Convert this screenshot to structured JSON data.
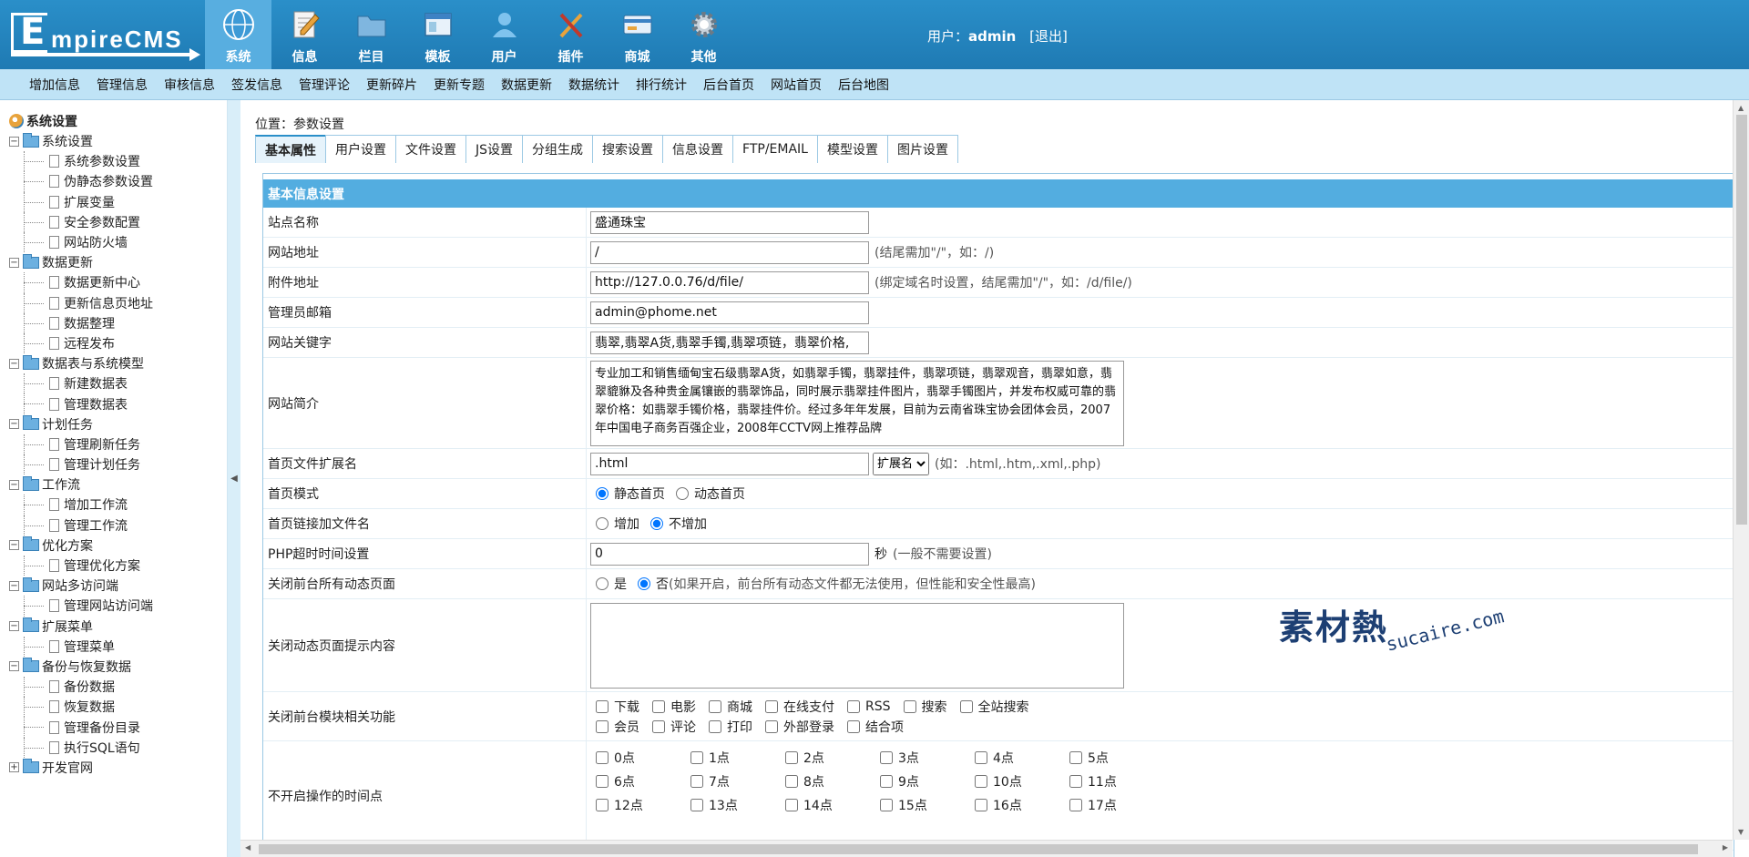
{
  "header": {
    "logo_text": "EmpireCMS",
    "nav": [
      {
        "label": "系统",
        "icon": "globe-icon",
        "active": true
      },
      {
        "label": "信息",
        "icon": "edit-icon"
      },
      {
        "label": "栏目",
        "icon": "folder-icon"
      },
      {
        "label": "模板",
        "icon": "window-icon"
      },
      {
        "label": "用户",
        "icon": "user-icon"
      },
      {
        "label": "插件",
        "icon": "tools-icon"
      },
      {
        "label": "商城",
        "icon": "card-icon"
      },
      {
        "label": "其他",
        "icon": "gear-icon"
      }
    ],
    "user_prefix": "用户：",
    "user_name": "admin",
    "logout": "[退出]"
  },
  "submenu": [
    "增加信息",
    "管理信息",
    "审核信息",
    "签发信息",
    "管理评论",
    "更新碎片",
    "更新专题",
    "数据更新",
    "数据统计",
    "排行统计",
    "后台首页",
    "网站首页",
    "后台地图"
  ],
  "sidebar": {
    "root": "系统设置",
    "groups": [
      {
        "label": "系统设置",
        "items": [
          "系统参数设置",
          "伪静态参数设置",
          "扩展变量",
          "安全参数配置",
          "网站防火墙"
        ]
      },
      {
        "label": "数据更新",
        "items": [
          "数据更新中心",
          "更新信息页地址",
          "数据整理",
          "远程发布"
        ]
      },
      {
        "label": "数据表与系统模型",
        "items": [
          "新建数据表",
          "管理数据表"
        ]
      },
      {
        "label": "计划任务",
        "items": [
          "管理刷新任务",
          "管理计划任务"
        ]
      },
      {
        "label": "工作流",
        "items": [
          "增加工作流",
          "管理工作流"
        ]
      },
      {
        "label": "优化方案",
        "items": [
          "管理优化方案"
        ]
      },
      {
        "label": "网站多访问端",
        "items": [
          "管理网站访问端"
        ]
      },
      {
        "label": "扩展菜单",
        "items": [
          "管理菜单"
        ]
      },
      {
        "label": "备份与恢复数据",
        "items": [
          "备份数据",
          "恢复数据",
          "管理备份目录",
          "执行SQL语句"
        ]
      },
      {
        "label": "开发官网",
        "items": []
      }
    ]
  },
  "main": {
    "location_prefix": "位置：",
    "location": "参数设置",
    "tabs": [
      "基本属性",
      "用户设置",
      "文件设置",
      "JS设置",
      "分组生成",
      "搜索设置",
      "信息设置",
      "FTP/EMAIL",
      "模型设置",
      "图片设置"
    ],
    "section_title": "基本信息设置",
    "fields": {
      "site_name": {
        "label": "站点名称",
        "value": "盛通珠宝"
      },
      "site_url": {
        "label": "网站地址",
        "value": "/",
        "hint": "(结尾需加\"/\"，如：/)"
      },
      "file_url": {
        "label": "附件地址",
        "value": "http://127.0.0.76/d/file/",
        "hint": "(绑定域名时设置，结尾需加\"/\"，如：/d/file/)"
      },
      "admin_email": {
        "label": "管理员邮箱",
        "value": "admin@phome.net"
      },
      "keywords": {
        "label": "网站关键字",
        "value": "翡翠,翡翠A货,翡翠手镯,翡翠项链，翡翠价格,"
      },
      "intro": {
        "label": "网站简介",
        "value": "专业加工和销售缅甸宝石级翡翠A货，如翡翠手镯，翡翠挂件，翡翠项链，翡翠观音，翡翠如意，翡翠貔貅及各种贵金属镶嵌的翡翠饰品，同时展示翡翠挂件图片，翡翠手镯图片，并发布权威可靠的翡翠价格：如翡翠手镯价格，翡翠挂件价。经过多年年发展，目前为云南省珠宝协会团体会员，2007年中国电子商务百强企业，2008年CCTV网上推荐品牌"
      },
      "index_ext": {
        "label": "首页文件扩展名",
        "value": ".html",
        "select": "扩展名",
        "hint": "(如：.html,.htm,.xml,.php)"
      },
      "index_mode": {
        "label": "首页模式",
        "opt1": "静态首页",
        "opt2": "动态首页"
      },
      "index_link": {
        "label": "首页链接加文件名",
        "opt1": "增加",
        "opt2": "不增加"
      },
      "php_timeout": {
        "label": "PHP超时时间设置",
        "value": "0",
        "unit": "秒",
        "hint": "(一般不需要设置)"
      },
      "close_dynamic": {
        "label": "关闭前台所有动态页面",
        "opt1": "是",
        "opt2": "否",
        "hint": "(如果开启，前台所有动态文件都无法使用，但性能和安全性最高)"
      },
      "close_msg": {
        "label": "关闭动态页面提示内容",
        "value": ""
      },
      "close_modules": {
        "label": "关闭前台模块相关功能",
        "row1": [
          "下载",
          "电影",
          "商城",
          "在线支付",
          "RSS",
          "搜索",
          "全站搜索"
        ],
        "row2": [
          "会员",
          "评论",
          "打印",
          "外部登录",
          "结合项"
        ]
      },
      "hours": {
        "label": "不开启操作的时间点",
        "items": [
          "0点",
          "1点",
          "2点",
          "3点",
          "4点",
          "5点",
          "6点",
          "7点",
          "8点",
          "9点",
          "10点",
          "11点",
          "12点",
          "13点",
          "14点",
          "15点",
          "16点",
          "17点"
        ]
      }
    }
  },
  "watermark": {
    "cn": "素材熱",
    "en": "sucaire.com"
  },
  "colors": {
    "header": "#2a8fc9",
    "subbar": "#bfe3f6",
    "section": "#53ade0"
  }
}
